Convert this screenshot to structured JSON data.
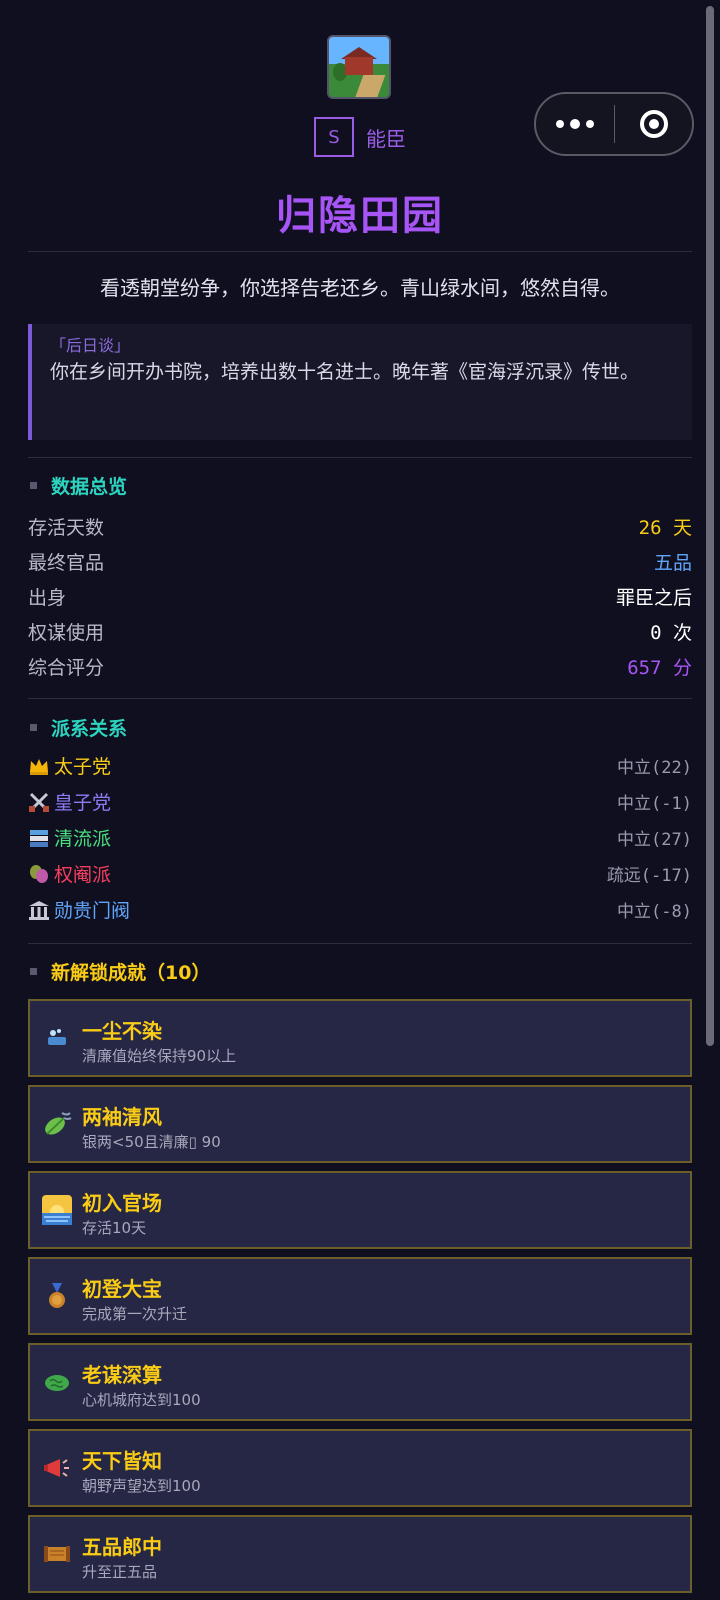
{
  "header": {
    "grade_letter": "S",
    "grade_label": "能臣",
    "title": "归隐田园",
    "icon": "countryside-house-icon"
  },
  "capsule": {
    "more_icon": "more-dots-icon",
    "close_icon": "target-icon"
  },
  "summary": "看透朝堂纷争，你选择告老还乡。青山绿水间，悠然自得。",
  "epilogue": {
    "tag": "「后日谈」",
    "text": "你在乡间开办书院，培养出数十名进士。晚年著《宦海浮沉录》传世。"
  },
  "stats": {
    "title": "数据总览",
    "items": [
      {
        "label": "存活天数",
        "value": "26 天",
        "color": "#facc15"
      },
      {
        "label": "最终官品",
        "value": "五品",
        "color": "#60a5fa"
      },
      {
        "label": "出身",
        "value": "罪臣之后",
        "color": "#ffffff"
      },
      {
        "label": "权谋使用",
        "value": "0 次",
        "color": "#ffffff"
      },
      {
        "label": "综合评分",
        "value": "657 分",
        "color": "#a855f7"
      }
    ]
  },
  "factions": {
    "title": "派系关系",
    "items": [
      {
        "icon": "crown-icon",
        "name": "太子党",
        "status": "中立(22)",
        "color": "#facc15"
      },
      {
        "icon": "crossed-swords-icon",
        "name": "皇子党",
        "status": "中立(-1)",
        "color": "#8b7cf6"
      },
      {
        "icon": "books-icon",
        "name": "清流派",
        "status": "中立(27)",
        "color": "#4ade80"
      },
      {
        "icon": "theater-masks-icon",
        "name": "权阉派",
        "status": "疏远(-17)",
        "color": "#f43f5e"
      },
      {
        "icon": "classical-building-icon",
        "name": "勋贵门阀",
        "status": "中立(-8)",
        "color": "#60a5fa"
      }
    ]
  },
  "achievements": {
    "title": "新解锁成就（10）",
    "items": [
      {
        "icon": "soap-icon",
        "name": "一尘不染",
        "desc": "清廉值始终保持90以上"
      },
      {
        "icon": "leaf-wind-icon",
        "name": "两袖清风",
        "desc": "银两<50且清廉▯ 90"
      },
      {
        "icon": "sunrise-icon",
        "name": "初入官场",
        "desc": "存活10天"
      },
      {
        "icon": "medal-icon",
        "name": "初登大宝",
        "desc": "完成第一次升迁"
      },
      {
        "icon": "brain-icon",
        "name": "老谋深算",
        "desc": "心机城府达到100"
      },
      {
        "icon": "megaphone-icon",
        "name": "天下皆知",
        "desc": "朝野声望达到100"
      },
      {
        "icon": "scroll-icon",
        "name": "五品郎中",
        "desc": "升至正五品"
      }
    ]
  }
}
